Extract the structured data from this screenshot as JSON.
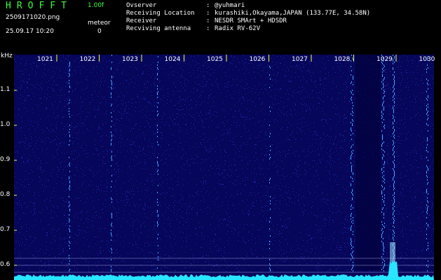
{
  "header": {
    "app_name": "HROFFT",
    "version": "1.00f",
    "file_name": "2509171020.png",
    "mode": "meteor",
    "timestamp": "25.09.17 10:20",
    "count": "0"
  },
  "info_rows": [
    {
      "label": "Ovserver",
      "value": "@yuhmari"
    },
    {
      "label": "Receiving Location",
      "value": "kurashiki,Okayama,JAPAN (133.77E, 34.58N)"
    },
    {
      "label": "Receiver",
      "value": "NESDR SMArt + HDSDR"
    },
    {
      "label": "Recviving antenna",
      "value": "Radix RV-62V"
    }
  ],
  "axis": {
    "y_unit": "kHz",
    "y_ticks": [
      "1.1",
      "1.0",
      "0.9",
      "0.8",
      "0.7",
      "0.6"
    ],
    "x_ticks": [
      "1021",
      "1022",
      "1023",
      "1024",
      "1025",
      "1026",
      "1027",
      "1028",
      "1029",
      "1030"
    ]
  },
  "colors": {
    "background": "#000000",
    "spectrogram": "#06065a",
    "signal": "#3fa9ff",
    "hot": "#9fe3ff",
    "tick": "#ffff33",
    "trace": "#28e6ff",
    "logo": "#3cff3c"
  }
}
